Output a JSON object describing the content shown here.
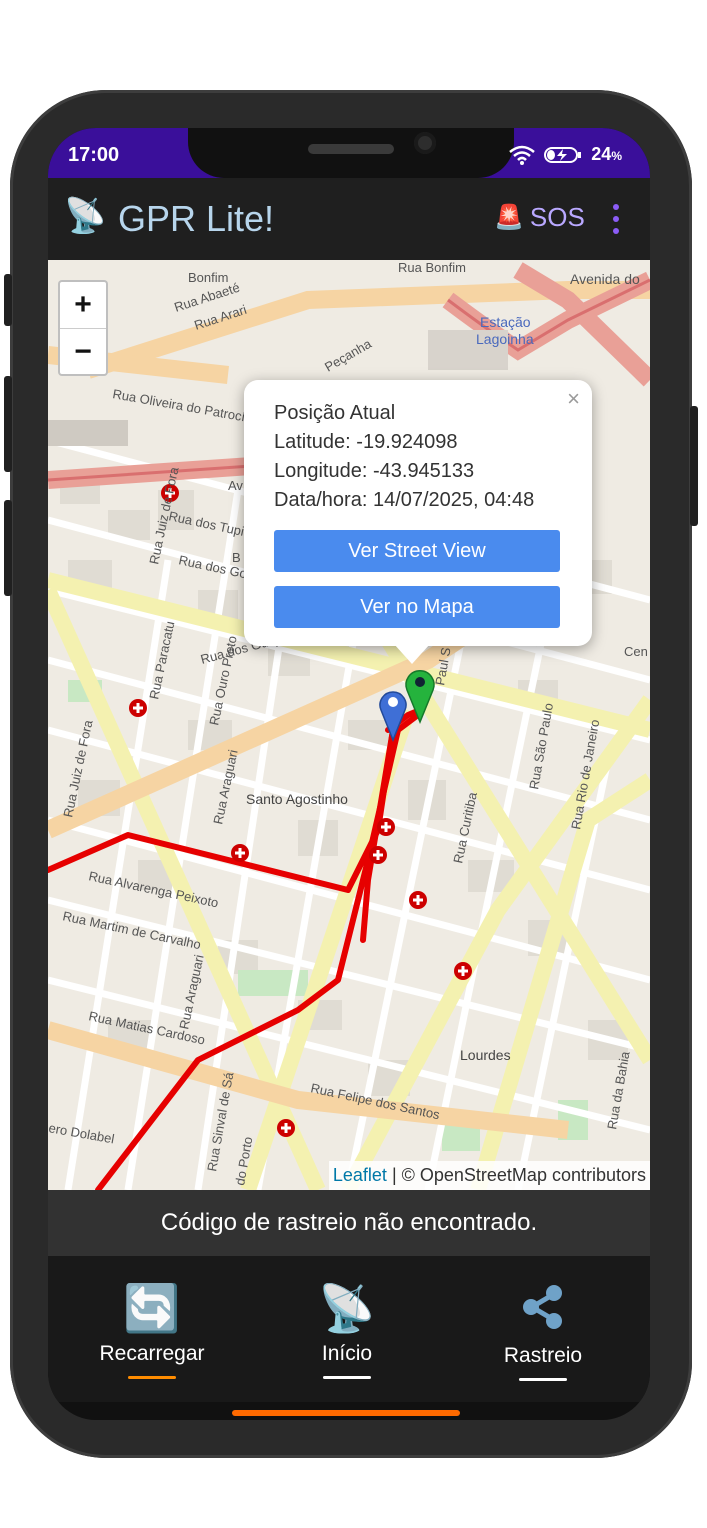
{
  "status_bar": {
    "time": "17:00",
    "battery": "24",
    "battery_unit": "%"
  },
  "app_bar": {
    "title": "GPR Lite!",
    "sos_label": "SOS"
  },
  "map": {
    "zoom_in": "+",
    "zoom_out": "−",
    "labels": {
      "bonfim": "Bonfim",
      "rua_bonfim": "Rua Bonfim",
      "avenida": "Avenida do",
      "estacao_1": "Estação",
      "estacao_2": "Lagoinha",
      "rua_abaete": "Rua Abaeté",
      "rua_arari": "Rua Arari",
      "rua_oliveira": "Rua Oliveira do Patrocí",
      "rua_pecanha": "Peçanha",
      "rua_juiz_fora": "Rua Juiz de Fora",
      "rua_tupis": "Rua dos Tupi",
      "rua_goita": "Rua dos Go",
      "rua_paracatu": "Rua Paracatu",
      "rua_guajajaras": "Rua dos Guajajaras",
      "rua_ouro_preto": "Rua Ouro Preto",
      "santo_agostinho": "Santo Agostinho",
      "rua_alvarenga": "Rua Alvarenga Peixoto",
      "rua_martim": "Rua Martim de Carvalho",
      "rua_matias": "Rua Matias Cardoso",
      "rua_curitiba": "Rua Curitiba",
      "rua_sao_paulo": "Rua São Paulo",
      "rua_rio_janeiro": "Rua Rio de Janeiro",
      "rua_paul": "Paul S",
      "lourdes": "Lourdes",
      "rua_felipe": "Rua Felipe dos Santos",
      "rua_bahia": "Rua da Bahia",
      "rua_araguari": "Rua Araguari",
      "ero_dolabela": "ero Dolabel",
      "rua_silval": "Rua Sinval de Sá",
      "do_porto": "do Porto",
      "cen": "Cen",
      "av": "Av",
      "b_letter": "B"
    },
    "attribution_leaflet": "Leaflet",
    "attribution_rest": " | © OpenStreetMap contributors"
  },
  "popup": {
    "close": "×",
    "title": "Posição Atual",
    "latitude": "Latitude: -19.924098",
    "longitude": "Longitude: -43.945133",
    "datetime": "Data/hora: 14/07/2025, 04:48",
    "btn_street_view": "Ver Street View",
    "btn_map": "Ver no Mapa"
  },
  "message": "Código de rastreio não encontrado.",
  "bottom_nav": [
    {
      "label": "Recarregar",
      "icon": "refresh-icon",
      "glyph": "🔄",
      "underline": "#ff8c00"
    },
    {
      "label": "Início",
      "icon": "satellite-dish-icon",
      "glyph": "📡",
      "underline": "#ffffff"
    },
    {
      "label": "Rastreio",
      "icon": "share-icon",
      "glyph": "",
      "underline": "#ffffff"
    }
  ],
  "colors": {
    "status_bar": "#3a0f9a",
    "app_title": "#b7d5ec",
    "sos": "#b9a8ff",
    "menu": "#8b5cf6",
    "route": "#e60000",
    "popup_button": "#4a8bee"
  }
}
